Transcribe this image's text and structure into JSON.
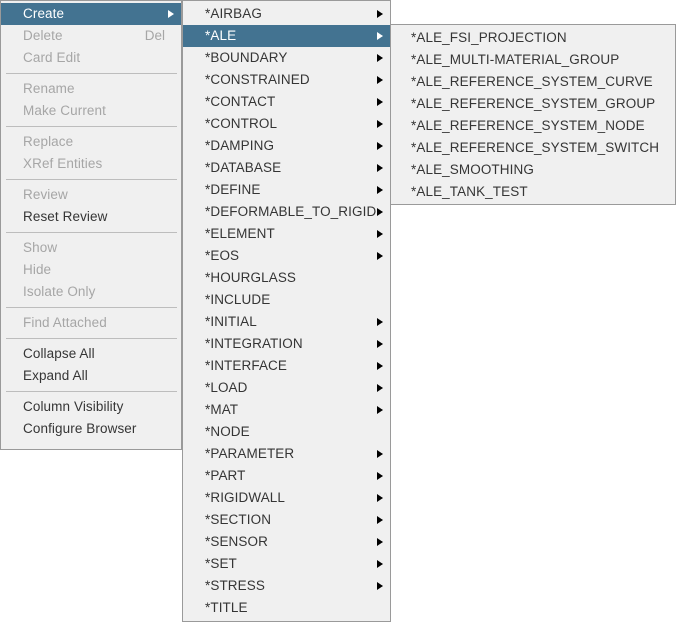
{
  "colors": {
    "menu_background": "#f0f0f0",
    "menu_border": "#9a9a9a",
    "highlight": "#437391",
    "highlight_text": "#ffffff",
    "text_enabled": "#353535",
    "text_disabled": "#a6a6a6",
    "separator": "#bdbdbd",
    "page_background": "#ffffff"
  },
  "context_menu": {
    "name": "Create context menu",
    "groups": [
      {
        "items": [
          {
            "label": "Create",
            "shortcut": "",
            "state": "highlight",
            "submenu": true
          },
          {
            "label": "Delete",
            "shortcut": "Del",
            "state": "disabled",
            "submenu": false
          },
          {
            "label": "Card Edit",
            "shortcut": "",
            "state": "disabled",
            "submenu": false
          }
        ]
      },
      {
        "items": [
          {
            "label": "Rename",
            "shortcut": "",
            "state": "disabled",
            "submenu": false
          },
          {
            "label": "Make Current",
            "shortcut": "",
            "state": "disabled",
            "submenu": false
          }
        ]
      },
      {
        "items": [
          {
            "label": "Replace",
            "shortcut": "",
            "state": "disabled",
            "submenu": false
          },
          {
            "label": "XRef Entities",
            "shortcut": "",
            "state": "disabled",
            "submenu": false
          }
        ]
      },
      {
        "items": [
          {
            "label": "Review",
            "shortcut": "",
            "state": "disabled",
            "submenu": false
          },
          {
            "label": "Reset Review",
            "shortcut": "",
            "state": "enabled",
            "submenu": false
          }
        ]
      },
      {
        "items": [
          {
            "label": "Show",
            "shortcut": "",
            "state": "disabled",
            "submenu": false
          },
          {
            "label": "Hide",
            "shortcut": "",
            "state": "disabled",
            "submenu": false
          },
          {
            "label": "Isolate Only",
            "shortcut": "",
            "state": "disabled",
            "submenu": false
          }
        ]
      },
      {
        "items": [
          {
            "label": "Find Attached",
            "shortcut": "",
            "state": "disabled",
            "submenu": false
          }
        ]
      },
      {
        "items": [
          {
            "label": "Collapse All",
            "shortcut": "",
            "state": "enabled",
            "submenu": false
          },
          {
            "label": "Expand All",
            "shortcut": "",
            "state": "enabled",
            "submenu": false
          }
        ]
      },
      {
        "items": [
          {
            "label": "Column Visibility",
            "shortcut": "",
            "state": "enabled",
            "submenu": false
          },
          {
            "label": "Configure Browser",
            "shortcut": "",
            "state": "enabled",
            "submenu": false
          }
        ]
      }
    ]
  },
  "keyword_menu": {
    "name": "Create submenu - LS-DYNA keywords",
    "items": [
      {
        "label": "*AIRBAG",
        "state": "enabled",
        "submenu": true
      },
      {
        "label": "*ALE",
        "state": "highlight",
        "submenu": true
      },
      {
        "label": "*BOUNDARY",
        "state": "enabled",
        "submenu": true
      },
      {
        "label": "*CONSTRAINED",
        "state": "enabled",
        "submenu": true
      },
      {
        "label": "*CONTACT",
        "state": "enabled",
        "submenu": true
      },
      {
        "label": "*CONTROL",
        "state": "enabled",
        "submenu": true
      },
      {
        "label": "*DAMPING",
        "state": "enabled",
        "submenu": true
      },
      {
        "label": "*DATABASE",
        "state": "enabled",
        "submenu": true
      },
      {
        "label": "*DEFINE",
        "state": "enabled",
        "submenu": true
      },
      {
        "label": "*DEFORMABLE_TO_RIGID",
        "state": "enabled",
        "submenu": true
      },
      {
        "label": "*ELEMENT",
        "state": "enabled",
        "submenu": true
      },
      {
        "label": "*EOS",
        "state": "enabled",
        "submenu": true
      },
      {
        "label": "*HOURGLASS",
        "state": "enabled",
        "submenu": false
      },
      {
        "label": "*INCLUDE",
        "state": "enabled",
        "submenu": false
      },
      {
        "label": "*INITIAL",
        "state": "enabled",
        "submenu": true
      },
      {
        "label": "*INTEGRATION",
        "state": "enabled",
        "submenu": true
      },
      {
        "label": "*INTERFACE",
        "state": "enabled",
        "submenu": true
      },
      {
        "label": "*LOAD",
        "state": "enabled",
        "submenu": true
      },
      {
        "label": "*MAT",
        "state": "enabled",
        "submenu": true
      },
      {
        "label": "*NODE",
        "state": "enabled",
        "submenu": false
      },
      {
        "label": "*PARAMETER",
        "state": "enabled",
        "submenu": true
      },
      {
        "label": "*PART",
        "state": "enabled",
        "submenu": true
      },
      {
        "label": "*RIGIDWALL",
        "state": "enabled",
        "submenu": true
      },
      {
        "label": "*SECTION",
        "state": "enabled",
        "submenu": true
      },
      {
        "label": "*SENSOR",
        "state": "enabled",
        "submenu": true
      },
      {
        "label": "*SET",
        "state": "enabled",
        "submenu": true
      },
      {
        "label": "*STRESS",
        "state": "enabled",
        "submenu": true
      },
      {
        "label": "*TITLE",
        "state": "enabled",
        "submenu": false
      }
    ]
  },
  "ale_menu": {
    "name": "*ALE submenu",
    "items": [
      {
        "label": "*ALE_FSI_PROJECTION",
        "state": "enabled",
        "submenu": false
      },
      {
        "label": "*ALE_MULTI-MATERIAL_GROUP",
        "state": "enabled",
        "submenu": false
      },
      {
        "label": "*ALE_REFERENCE_SYSTEM_CURVE",
        "state": "enabled",
        "submenu": false
      },
      {
        "label": "*ALE_REFERENCE_SYSTEM_GROUP",
        "state": "enabled",
        "submenu": false
      },
      {
        "label": "*ALE_REFERENCE_SYSTEM_NODE",
        "state": "enabled",
        "submenu": false
      },
      {
        "label": "*ALE_REFERENCE_SYSTEM_SWITCH",
        "state": "enabled",
        "submenu": false
      },
      {
        "label": "*ALE_SMOOTHING",
        "state": "enabled",
        "submenu": false
      },
      {
        "label": "*ALE_TANK_TEST",
        "state": "enabled",
        "submenu": false
      }
    ]
  }
}
